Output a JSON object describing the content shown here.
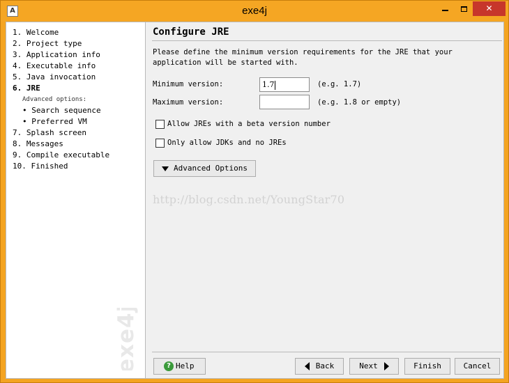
{
  "window": {
    "title": "exe4j",
    "app_icon": "A",
    "controls": [
      "minimize-icon",
      "maximize-icon",
      "close-icon"
    ],
    "close_glyph": "✕"
  },
  "sidebar": {
    "steps": [
      {
        "label": "1. Welcome"
      },
      {
        "label": "2. Project type"
      },
      {
        "label": "3. Application info"
      },
      {
        "label": "4. Executable info"
      },
      {
        "label": "5. Java invocation"
      },
      {
        "label": "6.  JRE"
      }
    ],
    "advanced_header": "Advanced options:",
    "advanced_steps": [
      {
        "label": "• Search sequence"
      },
      {
        "label": "• Preferred VM"
      }
    ],
    "steps_after": [
      {
        "label": "7. Splash screen"
      },
      {
        "label": "8. Messages"
      },
      {
        "label": "9. Compile executable"
      },
      {
        "label": "10.  Finished"
      }
    ],
    "brand": "exe4j"
  },
  "content": {
    "title": "Configure JRE",
    "description": "Please define the minimum version requirements for the JRE that your application will be started with.",
    "min_version_label": "Minimum version:",
    "min_version_value": "1.7",
    "min_version_hint": "(e.g. 1.7)",
    "max_version_label": "Maximum version:",
    "max_version_value": "",
    "max_version_hint": "(e.g. 1.8 or empty)",
    "allow_beta_label": "Allow JREs with a beta version number",
    "allow_beta_checked": false,
    "jdk_only_label": "Only allow JDKs and no JREs",
    "jdk_only_checked": false,
    "advanced_button": "Advanced Options",
    "watermark": "http://blog.csdn.net/YoungStar70"
  },
  "footer": {
    "help": "Help",
    "back": "Back",
    "next": "Next",
    "finish": "Finish",
    "cancel": "Cancel"
  },
  "colors": {
    "titlebar": "#f5a623",
    "close_button": "#c7362b",
    "help_icon": "#3a9a3a"
  }
}
